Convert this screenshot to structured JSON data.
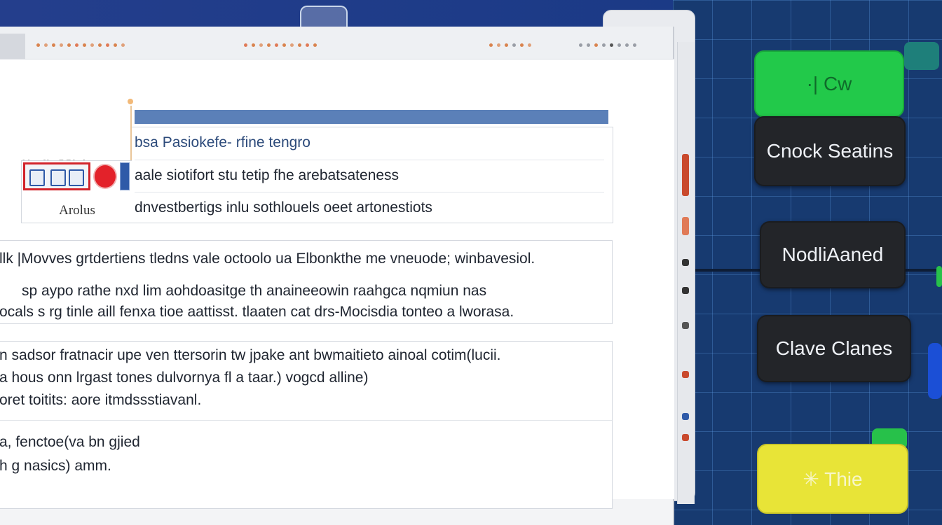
{
  "colors": {
    "accent_blue": "#5b80b8",
    "highlight_red": "#d2232a",
    "game_green": "#22c94a",
    "game_dark": "#232529",
    "game_yellow": "#e8e437",
    "grid_bg": "#173a70"
  },
  "page": {
    "left_label": "Mavs Kee E Fd e l",
    "nav_card_label": "Arolus",
    "results": [
      "bsa Pasiokefe- rfine tengro",
      "aale siotifort stu tetip fhe arebatsateness",
      "dnvestbertigs  inlu sothlouels oeet artonestiots"
    ],
    "block1": [
      "llk |Movves grtdertiens tledns vale octoolo ua Elbonkthe me vneuode; winbavesiol.",
      "sp aypo rathe nxd lim  aohdoasitge th anaineeowin raahgca nqmiun nas",
      "ocals s rg tinle aill fenxa tioe aattisst. tlaaten cat drs-Mocisdia tonteo a lworasa."
    ],
    "block2": [
      "n sadsor fratnacir upe ven ttersorin tw jpake ant bwmaitieto ainoal cotim(lucii.",
      "a hous onn lrgast tones dulvornya fl a taar.) vogcd alline)",
      "oret toitits: aore itmdssstiavanl."
    ],
    "block3": [
      "a, fenctoe(va bn gjied",
      "h g nasics) amm."
    ]
  },
  "game": {
    "buttons": [
      {
        "label": "·|  Cw"
      },
      {
        "label": "Cnock Seatins"
      },
      {
        "label": "NodliAaned"
      },
      {
        "label": "Clave  Clanes"
      },
      {
        "label": "✳ Thie"
      }
    ]
  },
  "icons": {
    "address_icon": "binoculars-icon",
    "strip": [
      "doc-icon",
      "chart-icon",
      "text-icon"
    ],
    "drop": "red-drop-icon"
  }
}
